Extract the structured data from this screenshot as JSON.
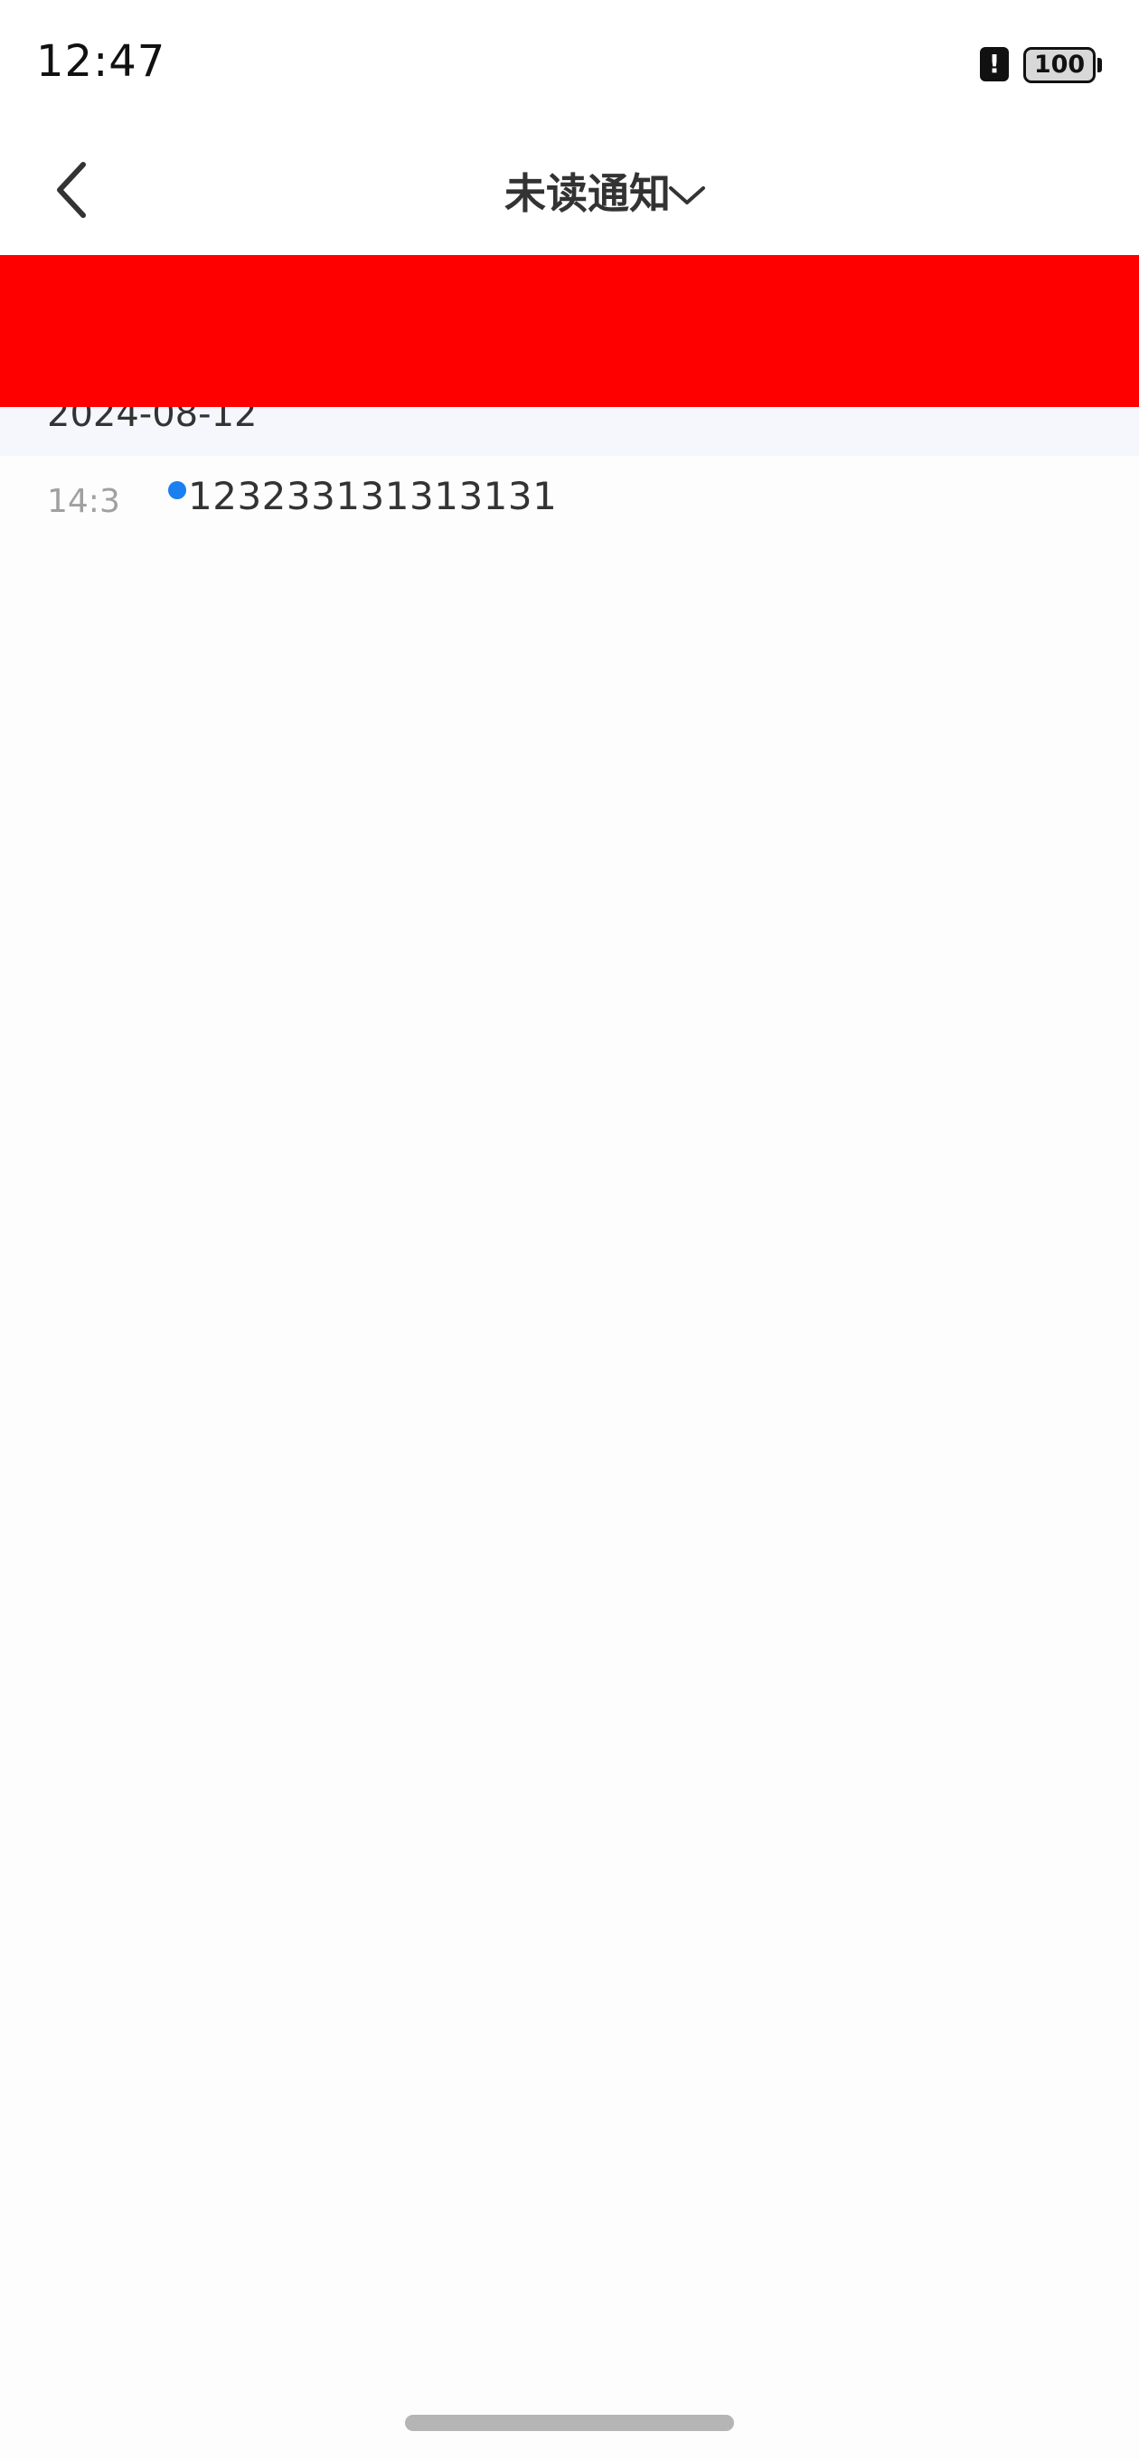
{
  "status_bar": {
    "time": "12:47",
    "alert_icon": "alert-icon",
    "alert_symbol": "!",
    "battery_level": "100"
  },
  "nav": {
    "back_icon": "chevron-left-icon",
    "title": "未读通知",
    "dropdown_icon": "chevron-down-icon"
  },
  "banner": {
    "color": "#ff0000"
  },
  "notifications": {
    "groups": [
      {
        "date": "2024-08-12",
        "items": [
          {
            "time": "14:3",
            "text": "123233131313131",
            "unread": true,
            "dot_color": "#1a7ff0"
          }
        ]
      }
    ]
  },
  "colors": {
    "accent": "#1a7ff0",
    "text_primary": "#333333",
    "text_secondary": "#a0a0a0",
    "group_header_bg": "#f6f7fd"
  }
}
